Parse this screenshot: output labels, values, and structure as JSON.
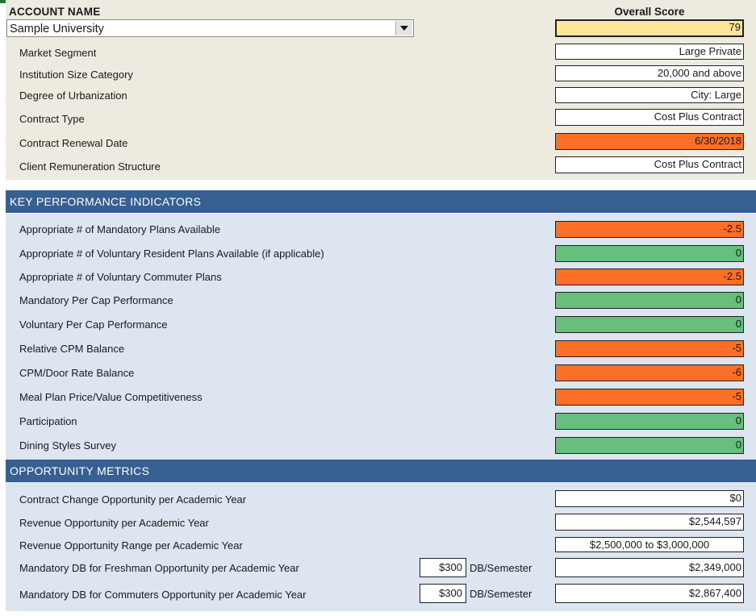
{
  "account": {
    "title": "ACCOUNT NAME",
    "selected": "Sample University",
    "dropdown_icon": "chevron-down-icon"
  },
  "overall_score": {
    "title": "Overall Score",
    "value": "79",
    "color": "#fde69a"
  },
  "account_fields": [
    {
      "label": "Market Segment",
      "value": "Large Private",
      "color": "#ffffff"
    },
    {
      "label": "Institution Size Category",
      "value": "20,000 and above",
      "color": "#ffffff"
    },
    {
      "label": "Degree of Urbanization",
      "value": "City: Large",
      "color": "#ffffff"
    },
    {
      "label": "Contract Type",
      "value": "Cost Plus Contract",
      "color": "#ffffff"
    },
    {
      "label": "Contract Renewal Date",
      "value": "6/30/2018",
      "color": "#fd6f27"
    },
    {
      "label": "Client Remuneration Structure",
      "value": "Cost Plus Contract",
      "color": "#ffffff"
    }
  ],
  "kpi": {
    "title": "KEY PERFORMANCE INDICATORS",
    "items": [
      {
        "label": "Appropriate # of Mandatory Plans Available",
        "value": "-2.5",
        "status": "negative"
      },
      {
        "label": "Appropriate # of Voluntary Resident Plans Available (if applicable)",
        "value": "0",
        "status": "ok"
      },
      {
        "label": "Appropriate # of Voluntary Commuter Plans",
        "value": "-2.5",
        "status": "negative"
      },
      {
        "label": "Mandatory Per Cap Performance",
        "value": "0",
        "status": "ok"
      },
      {
        "label": "Voluntary Per Cap Performance",
        "value": "0",
        "status": "ok"
      },
      {
        "label": "Relative CPM Balance",
        "value": "-5",
        "status": "negative"
      },
      {
        "label": "CPM/Door Rate Balance",
        "value": "-6",
        "status": "negative"
      },
      {
        "label": "Meal Plan Price/Value Competitiveness",
        "value": "-5",
        "status": "negative"
      },
      {
        "label": "Participation",
        "value": "0",
        "status": "ok"
      },
      {
        "label": "Dining Styles Survey",
        "value": "0",
        "status": "ok"
      }
    ],
    "colors": {
      "negative": "#fd6f27",
      "ok": "#66bf7c"
    }
  },
  "opportunity": {
    "title": "OPPORTUNITY METRICS",
    "items": [
      {
        "label": "Contract Change Opportunity per Academic Year",
        "value": "$0"
      },
      {
        "label": "Revenue Opportunity per Academic Year",
        "value": "$2,544,597"
      },
      {
        "label": "Revenue Opportunity Range per Academic Year",
        "value": "$2,500,000 to $3,000,000"
      },
      {
        "label": "Mandatory DB for Freshman Opportunity per Academic Year",
        "input_value": "$300",
        "unit": "DB/Semester",
        "value": "$2,349,000"
      },
      {
        "label": "Mandatory DB for Commuters Opportunity per Academic Year",
        "input_value": "$300",
        "unit": "DB/Semester",
        "value": "$2,867,400"
      }
    ]
  },
  "colors": {
    "header_bg": "#365f92",
    "panel_bg": "#dce5f0",
    "top_panel_bg": "#edeae0"
  }
}
